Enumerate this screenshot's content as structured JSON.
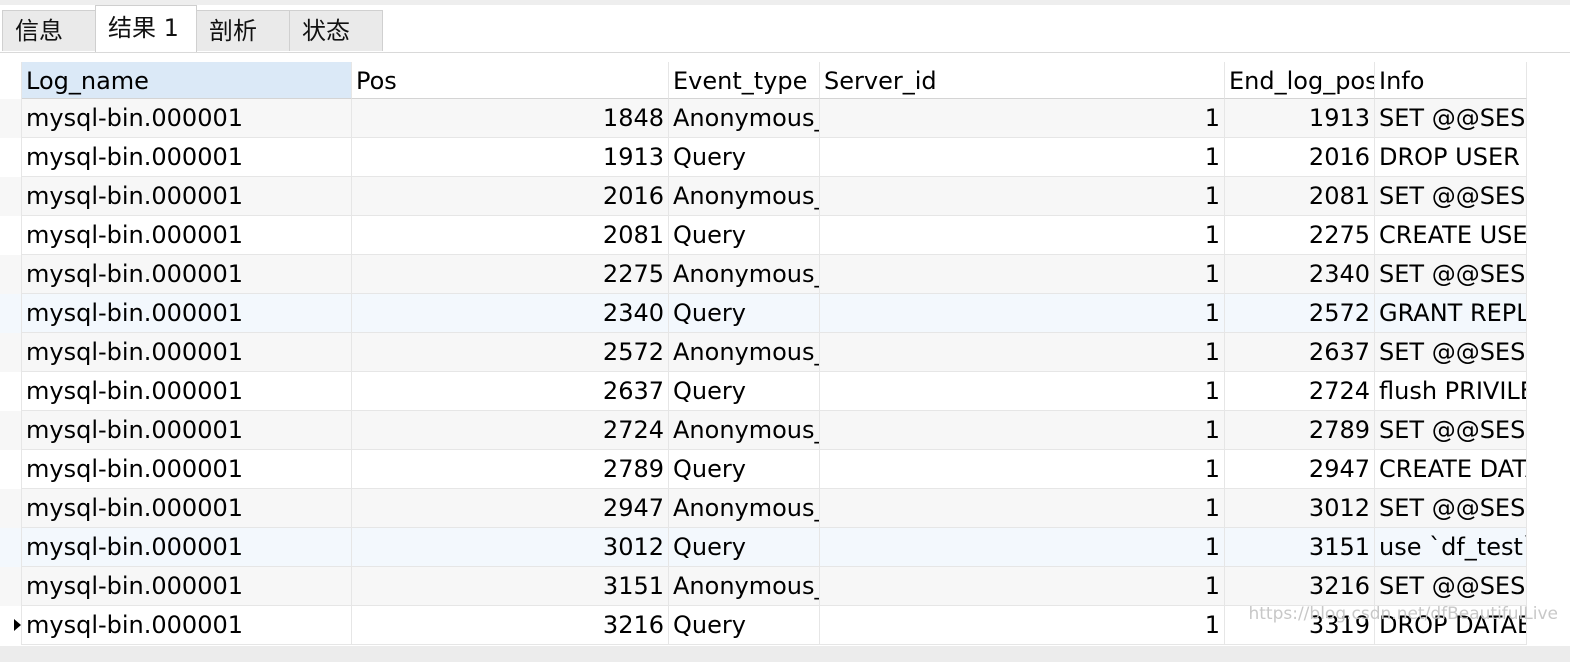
{
  "tabs": [
    "信息",
    "结果 1",
    "剖析",
    "状态"
  ],
  "active_tab_index": 1,
  "columns": [
    "Log_name",
    "Pos",
    "Event_type",
    "Server_id",
    "End_log_pos",
    "Info"
  ],
  "selected_column": "Log_name",
  "rows": [
    [
      "mysql-bin.000001",
      "1848",
      "Anonymous_",
      "1",
      "1913",
      "SET @@SESS"
    ],
    [
      "mysql-bin.000001",
      "1913",
      "Query",
      "1",
      "2016",
      "DROP USER `"
    ],
    [
      "mysql-bin.000001",
      "2016",
      "Anonymous_",
      "1",
      "2081",
      "SET @@SESS"
    ],
    [
      "mysql-bin.000001",
      "2081",
      "Query",
      "1",
      "2275",
      "CREATE USER"
    ],
    [
      "mysql-bin.000001",
      "2275",
      "Anonymous_",
      "1",
      "2340",
      "SET @@SESS"
    ],
    [
      "mysql-bin.000001",
      "2340",
      "Query",
      "1",
      "2572",
      "GRANT REPL"
    ],
    [
      "mysql-bin.000001",
      "2572",
      "Anonymous_",
      "1",
      "2637",
      "SET @@SESS"
    ],
    [
      "mysql-bin.000001",
      "2637",
      "Query",
      "1",
      "2724",
      "flush PRIVILE"
    ],
    [
      "mysql-bin.000001",
      "2724",
      "Anonymous_",
      "1",
      "2789",
      "SET @@SESS"
    ],
    [
      "mysql-bin.000001",
      "2789",
      "Query",
      "1",
      "2947",
      "CREATE DATA"
    ],
    [
      "mysql-bin.000001",
      "2947",
      "Anonymous_",
      "1",
      "3012",
      "SET @@SESS"
    ],
    [
      "mysql-bin.000001",
      "3012",
      "Query",
      "1",
      "3151",
      "use `df_test`;"
    ],
    [
      "mysql-bin.000001",
      "3151",
      "Anonymous_",
      "1",
      "3216",
      "SET @@SESS"
    ],
    [
      "mysql-bin.000001",
      "3216",
      "Query",
      "1",
      "3319",
      "DROP DATAB"
    ]
  ],
  "current_row_index": 13,
  "highlighted_row_indices": [
    5,
    11
  ],
  "watermark": "https://blog.csdn.net/dfBeautifulLive"
}
